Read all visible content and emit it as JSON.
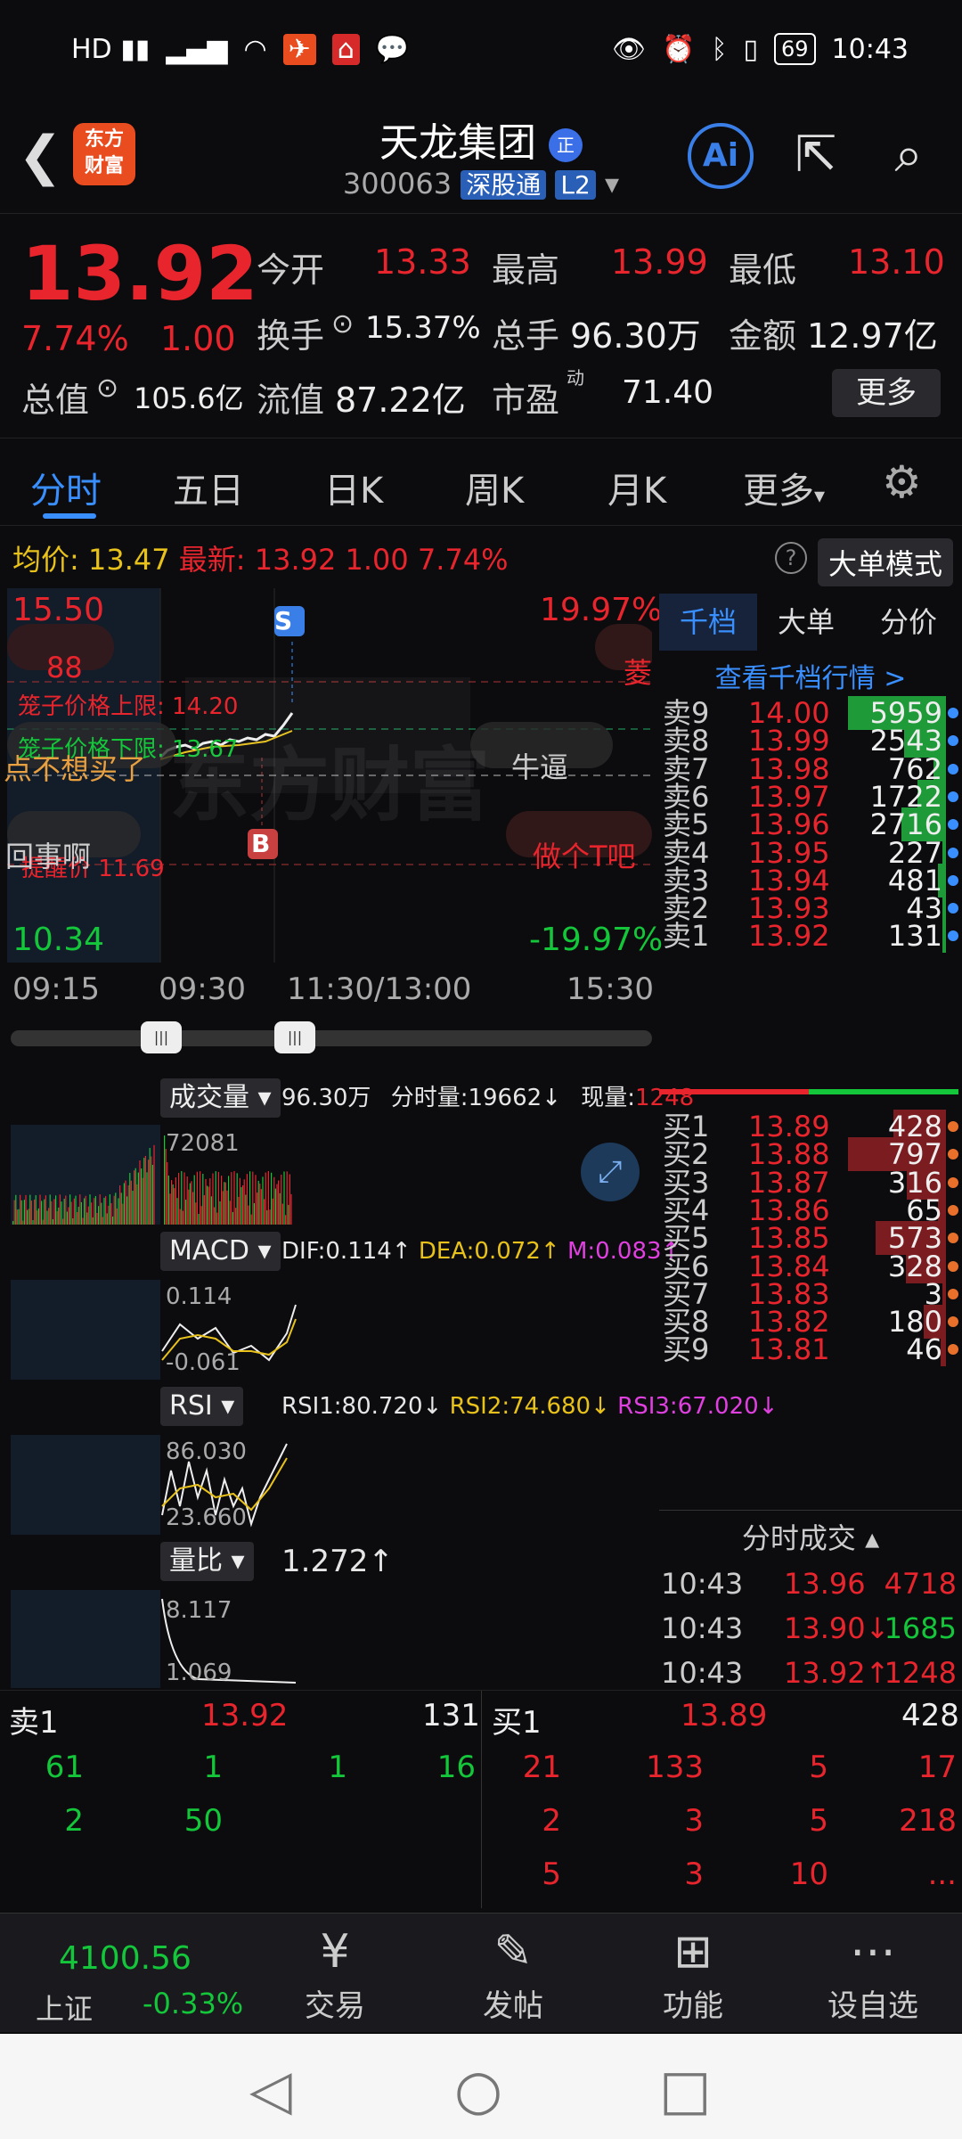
{
  "status_bar": {
    "left_icons": [
      "HD1",
      "HD2",
      "4G",
      "5G",
      "wifi",
      "nfc",
      "app1",
      "app2",
      "chat"
    ],
    "battery": "69",
    "time": "10:43"
  },
  "header": {
    "logo_line1": "东方",
    "logo_line2": "财富",
    "title": "天龙集团",
    "badge": "正",
    "code": "300063",
    "tag1": "深股通",
    "tag2": "L2",
    "ai": "Ai"
  },
  "quote": {
    "price": "13.92",
    "pct": "7.74%",
    "change": "1.00",
    "open_label": "今开",
    "open": "13.33",
    "high_label": "最高",
    "high": "13.99",
    "low_label": "最低",
    "low": "13.10",
    "turnover_label": "换手",
    "turnover": "15.37%",
    "vol_label": "总手",
    "vol": "96.30万",
    "amount_label": "金额",
    "amount": "12.97亿",
    "mktcap_label": "总值",
    "mktcap": "105.6亿",
    "float_label": "流值",
    "float": "87.22亿",
    "pe_label": "市盈",
    "pe_sup": "动",
    "pe": "71.40",
    "more": "更多"
  },
  "tabs": [
    "分时",
    "五日",
    "日K",
    "周K",
    "月K",
    "更多"
  ],
  "avg": {
    "label": "均价:",
    "value": "13.47",
    "latest_label": "最新:",
    "latest": "13.92",
    "chg": "1.00",
    "pct": "7.74%",
    "mode": "大单模式"
  },
  "chart_labels": {
    "top_left": "15.50",
    "top_right": "19.97%",
    "bottom_left": "10.34",
    "bottom_right": "-19.97%",
    "limit_up": "笼子价格上限: 14.20",
    "limit_down": "笼子价格下限: 13.67",
    "reminder": "提醒价 11.69",
    "s_marker": "S",
    "b_marker": "B",
    "watermark": "东方财富",
    "bubble_1": "88",
    "bubble_2": "菱",
    "bubble_3": "点不想买了",
    "bubble_4": "牛逼",
    "bubble_5": "回事啊",
    "bubble_6": "做个T吧",
    "times": [
      "09:15",
      "09:30",
      "11:30/13:00",
      "15:30"
    ]
  },
  "volume": {
    "label": "成交量",
    "total": "96.30万",
    "minute_label": "分时量:",
    "minute": "19662",
    "now_label": "现量:",
    "now": "1248",
    "peak": "72081"
  },
  "macd": {
    "label": "MACD",
    "dif": "DIF:0.114",
    "dea": "DEA:0.072",
    "m": "M:0.083",
    "top": "0.114",
    "bottom": "-0.061"
  },
  "rsi": {
    "label": "RSI",
    "rsi1": "RSI1:80.720",
    "rsi2": "RSI2:74.680",
    "rsi3": "RSI3:67.020",
    "top": "86.030",
    "bottom": "23.660"
  },
  "liangbi": {
    "label": "量比",
    "value": "1.272",
    "top": "8.117",
    "bottom": "1.069"
  },
  "orderbook": {
    "tabs": [
      "千档",
      "大单",
      "分价"
    ],
    "link": "查看千档行情 >",
    "asks": [
      [
        "卖9",
        "14.00",
        "5959"
      ],
      [
        "卖8",
        "13.99",
        "2543"
      ],
      [
        "卖7",
        "13.98",
        "762"
      ],
      [
        "卖6",
        "13.97",
        "1722"
      ],
      [
        "卖5",
        "13.96",
        "2716"
      ],
      [
        "卖4",
        "13.95",
        "227"
      ],
      [
        "卖3",
        "13.94",
        "481"
      ],
      [
        "卖2",
        "13.93",
        "43"
      ],
      [
        "卖1",
        "13.92",
        "131"
      ]
    ],
    "bids": [
      [
        "买1",
        "13.89",
        "428"
      ],
      [
        "买2",
        "13.88",
        "797"
      ],
      [
        "买3",
        "13.87",
        "316"
      ],
      [
        "买4",
        "13.86",
        "65"
      ],
      [
        "买5",
        "13.85",
        "573"
      ],
      [
        "买6",
        "13.84",
        "328"
      ],
      [
        "买7",
        "13.83",
        "3"
      ],
      [
        "买8",
        "13.82",
        "180"
      ],
      [
        "买9",
        "13.81",
        "46"
      ]
    ],
    "trades_header": "分时成交",
    "trades": [
      [
        "10:43",
        "13.96",
        "4718"
      ],
      [
        "10:43",
        "13.90↓",
        "1685"
      ],
      [
        "10:43",
        "13.92↑",
        "1248"
      ]
    ],
    "colors": {
      "up": "#e8252d",
      "down": "#14c63a",
      "bar": "#1e9a38"
    }
  },
  "levels": {
    "sell_label": "卖1",
    "sell_price": "13.92",
    "sell_vol": "131",
    "buy_label": "买1",
    "buy_price": "13.89",
    "buy_vol": "428",
    "sell_rows": [
      [
        "61",
        "1",
        "1",
        "16"
      ],
      [
        "2",
        "50",
        "",
        ""
      ]
    ],
    "buy_rows": [
      [
        "21",
        "133",
        "5",
        "17"
      ],
      [
        "2",
        "3",
        "5",
        "218"
      ],
      [
        "5",
        "3",
        "10",
        "..."
      ]
    ]
  },
  "bottom_nav": {
    "index_value": "4100.56",
    "index_name": "上证",
    "index_pct": "-0.33%",
    "items": [
      "交易",
      "发帖",
      "功能",
      "设自选"
    ]
  }
}
